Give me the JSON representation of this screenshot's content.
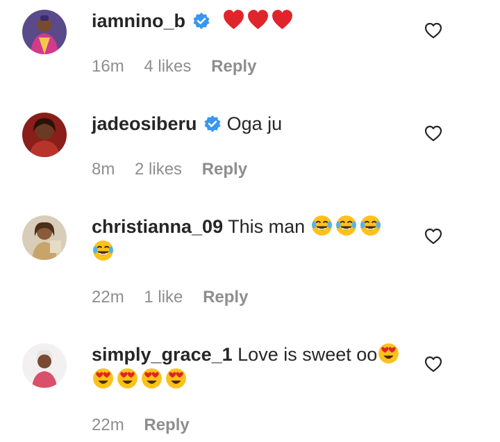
{
  "comments": [
    {
      "username": "iamnino_b",
      "verified": true,
      "text": "",
      "emojis_line1": [
        "red-heart",
        "red-heart",
        "red-heart"
      ],
      "emojis_line2": [],
      "time": "16m",
      "likes": "4 likes",
      "reply": "Reply"
    },
    {
      "username": "jadeosiberu",
      "verified": true,
      "text": "Oga ju",
      "emojis_line1": [],
      "emojis_line2": [],
      "time": "8m",
      "likes": "2 likes",
      "reply": "Reply"
    },
    {
      "username": "christianna_09",
      "verified": false,
      "text": "This man",
      "emojis_line1": [
        "tears-of-joy",
        "tears-of-joy",
        "tears-of-joy"
      ],
      "emojis_line2": [
        "tears-of-joy"
      ],
      "time": "22m",
      "likes": "1 like",
      "reply": "Reply"
    },
    {
      "username": "simply_grace_1",
      "verified": false,
      "text": "Love is sweet oo",
      "emojis_line1": [
        "heart-eyes"
      ],
      "emojis_line2": [
        "heart-eyes",
        "heart-eyes",
        "heart-eyes",
        "heart-eyes"
      ],
      "time": "22m",
      "likes": "",
      "reply": "Reply"
    }
  ],
  "colors": {
    "verified": "#3897f0",
    "meta": "#8e8e8e",
    "text": "#262626"
  }
}
